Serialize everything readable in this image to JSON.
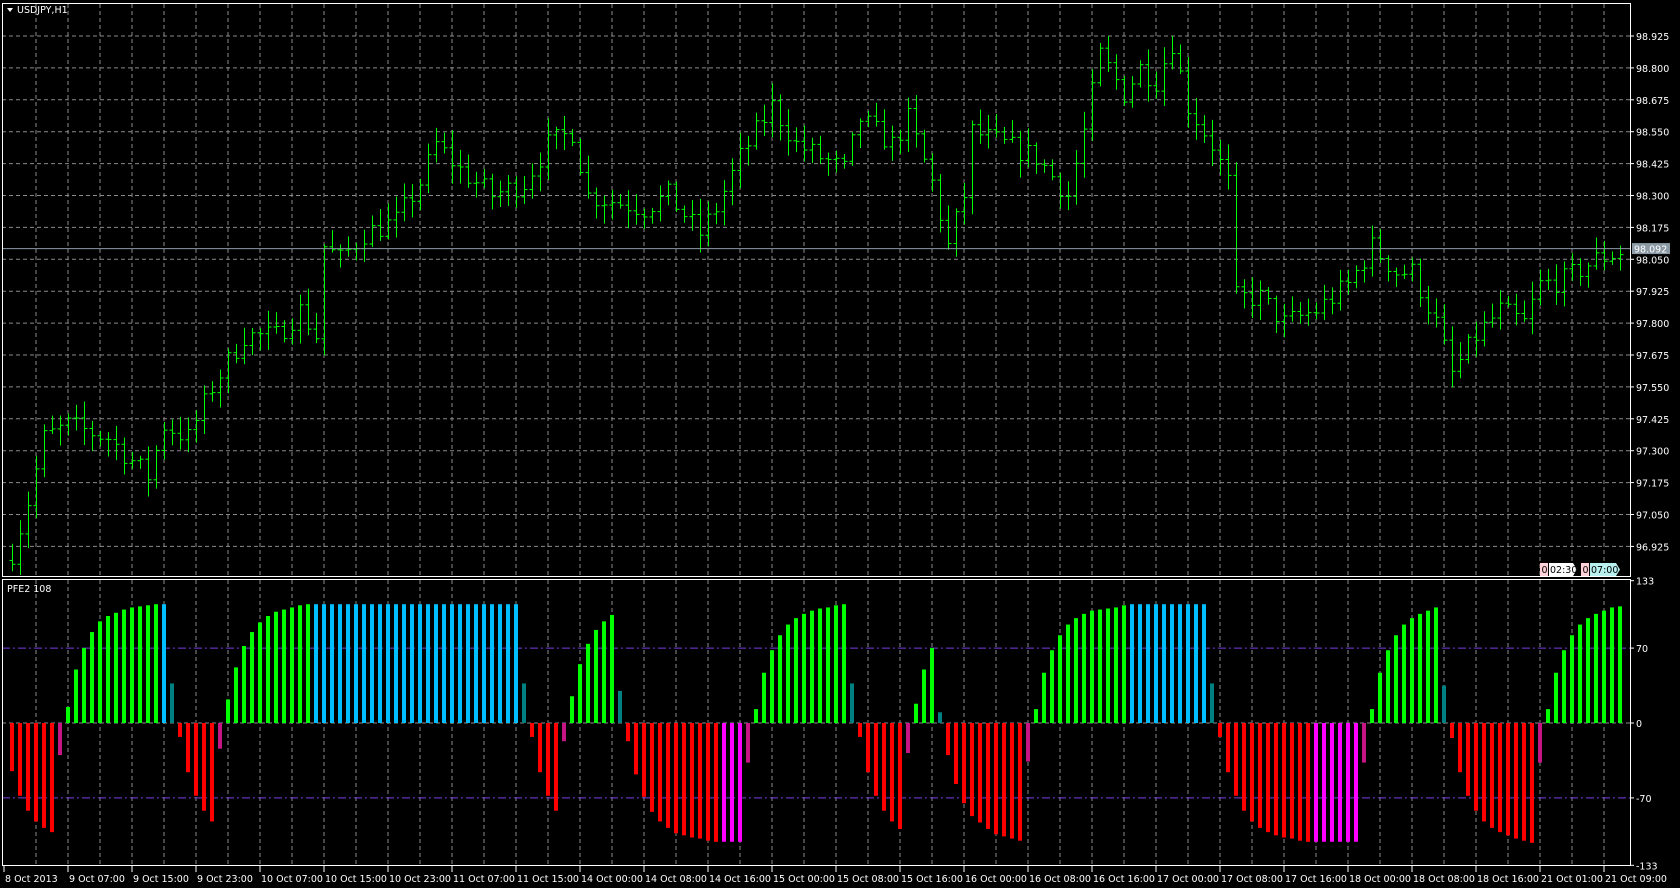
{
  "main_chart": {
    "title": "USDJPY,H1",
    "price_labels": [
      "98.925",
      "98.800",
      "98.675",
      "98.550",
      "98.425",
      "98.300",
      "98.175",
      "98.050",
      "97.925",
      "97.800",
      "97.675",
      "97.550",
      "97.425",
      "97.300",
      "97.175",
      "97.050",
      "96.925"
    ],
    "current_price": "98.092",
    "current_price_value": 98.092,
    "bar_color": "#00ff00",
    "tags": [
      {
        "count": "0",
        "time": "02:30"
      },
      {
        "count": "0",
        "time": "07:00"
      }
    ]
  },
  "indicator": {
    "title": "PFE2 108",
    "levels": [
      "133",
      "70",
      "0",
      "-70",
      "-133"
    ],
    "level_values": [
      133,
      70,
      0,
      -70,
      -133
    ]
  },
  "time_labels": [
    "8 Oct 2013",
    "9 Oct 07:00",
    "9 Oct 15:00",
    "9 Oct 23:00",
    "10 Oct 07:00",
    "10 Oct 15:00",
    "10 Oct 23:00",
    "11 Oct 07:00",
    "11 Oct 15:00",
    "14 Oct 00:00",
    "14 Oct 08:00",
    "14 Oct 16:00",
    "15 Oct 00:00",
    "15 Oct 08:00",
    "15 Oct 16:00",
    "16 Oct 00:00",
    "16 Oct 08:00",
    "16 Oct 16:00",
    "17 Oct 00:00",
    "17 Oct 08:00",
    "17 Oct 16:00",
    "18 Oct 00:00",
    "18 Oct 08:00",
    "18 Oct 16:00",
    "21 Oct 01:00",
    "21 Oct 09:00"
  ],
  "chart_data": [
    {
      "type": "ohlc",
      "title": "USDJPY,H1",
      "ylim": [
        96.86,
        98.99
      ],
      "bar_count": 202,
      "close_keypoints": [
        [
          0,
          96.9
        ],
        [
          2,
          97.1
        ],
        [
          4,
          97.35
        ],
        [
          7,
          97.4
        ],
        [
          12,
          97.35
        ],
        [
          17,
          97.2
        ],
        [
          19,
          97.4
        ],
        [
          22,
          97.35
        ],
        [
          25,
          97.55
        ],
        [
          29,
          97.75
        ],
        [
          33,
          97.75
        ],
        [
          36,
          97.85
        ],
        [
          38,
          97.75
        ],
        [
          39,
          98.1
        ],
        [
          41,
          98.05
        ],
        [
          44,
          98.15
        ],
        [
          48,
          98.2
        ],
        [
          51,
          98.35
        ],
        [
          53,
          98.5
        ],
        [
          56,
          98.4
        ],
        [
          60,
          98.3
        ],
        [
          64,
          98.35
        ],
        [
          67,
          98.5
        ],
        [
          70,
          98.55
        ],
        [
          72,
          98.3
        ],
        [
          79,
          98.25
        ],
        [
          82,
          98.3
        ],
        [
          86,
          98.15
        ],
        [
          88,
          98.25
        ],
        [
          91,
          98.45
        ],
        [
          95,
          98.65
        ],
        [
          98,
          98.5
        ],
        [
          104,
          98.4
        ],
        [
          106,
          98.6
        ],
        [
          110,
          98.5
        ],
        [
          112,
          98.6
        ],
        [
          115,
          98.35
        ],
        [
          117,
          98.1
        ],
        [
          119,
          98.3
        ],
        [
          120,
          98.55
        ],
        [
          124,
          98.5
        ],
        [
          128,
          98.45
        ],
        [
          132,
          98.3
        ],
        [
          134,
          98.55
        ],
        [
          136,
          98.85
        ],
        [
          139,
          98.7
        ],
        [
          141,
          98.8
        ],
        [
          143,
          98.75
        ],
        [
          145,
          98.9
        ],
        [
          147,
          98.65
        ],
        [
          150,
          98.5
        ],
        [
          152,
          98.35
        ],
        [
          153,
          97.9
        ],
        [
          156,
          97.9
        ],
        [
          159,
          97.8
        ],
        [
          163,
          97.85
        ],
        [
          167,
          97.95
        ],
        [
          170,
          98.1
        ],
        [
          173,
          98.0
        ],
        [
          175,
          98.0
        ],
        [
          178,
          97.8
        ],
        [
          180,
          97.6
        ],
        [
          183,
          97.75
        ],
        [
          186,
          97.85
        ],
        [
          189,
          97.8
        ],
        [
          191,
          97.95
        ],
        [
          194,
          97.97
        ],
        [
          198,
          98.05
        ],
        [
          201,
          98.08
        ]
      ]
    },
    {
      "type": "histogram",
      "title": "PFE2 108",
      "ylim": [
        -133,
        133
      ],
      "levels": [
        70,
        0,
        -70
      ],
      "colors": {
        "up": "#00ff00",
        "up_max": "#00bfff",
        "up_fade": "#008080",
        "down": "#ff0000",
        "down_max": "#ff00ff",
        "down_fade": "#c71585"
      },
      "segments": [
        {
          "color": "down",
          "values": [
            -45,
            -68,
            -82,
            -92,
            -98,
            -102
          ]
        },
        {
          "color": "down_fade",
          "values": [
            -30
          ]
        },
        {
          "color": "up",
          "values": [
            15,
            50,
            70,
            85,
            95,
            100,
            103,
            106,
            108,
            109,
            110,
            111
          ]
        },
        {
          "color": "up_max",
          "values": [
            111
          ]
        },
        {
          "color": "up_fade",
          "values": [
            37
          ]
        },
        {
          "color": "down",
          "values": [
            -13,
            -46,
            -68,
            -82,
            -92
          ]
        },
        {
          "color": "down_fade",
          "values": [
            -24
          ]
        },
        {
          "color": "up",
          "values": [
            22,
            52,
            72,
            85,
            94,
            100,
            104,
            106,
            108,
            110,
            111
          ]
        },
        {
          "color": "up_max",
          "values": [
            111,
            111,
            111,
            111,
            111,
            111,
            111,
            111,
            111,
            111,
            111,
            111,
            111,
            111,
            111,
            111,
            111,
            111,
            111,
            111,
            111,
            111,
            111,
            111,
            111,
            111
          ]
        },
        {
          "color": "up_fade",
          "values": [
            37
          ]
        },
        {
          "color": "down",
          "values": [
            -13,
            -46,
            -68,
            -82
          ]
        },
        {
          "color": "down_fade",
          "values": [
            -17
          ]
        },
        {
          "color": "up",
          "values": [
            25,
            55,
            74,
            87,
            95,
            101
          ]
        },
        {
          "color": "up_fade",
          "values": [
            30
          ]
        },
        {
          "color": "down",
          "values": [
            -17,
            -48,
            -69,
            -83,
            -92,
            -98,
            -103,
            -105,
            -107,
            -108,
            -110,
            -111
          ]
        },
        {
          "color": "down_max",
          "values": [
            -111,
            -111,
            -111
          ]
        },
        {
          "color": "down_fade",
          "values": [
            -37
          ]
        },
        {
          "color": "up",
          "values": [
            13,
            47,
            68,
            82,
            92,
            98,
            102,
            105,
            107,
            108,
            110,
            111
          ]
        },
        {
          "color": "up_fade",
          "values": [
            37
          ]
        },
        {
          "color": "down",
          "values": [
            -13,
            -46,
            -68,
            -82,
            -92,
            -99
          ]
        },
        {
          "color": "down_fade",
          "values": [
            -28
          ]
        },
        {
          "color": "up",
          "values": [
            18,
            50,
            70
          ]
        },
        {
          "color": "up_fade",
          "values": [
            10
          ]
        },
        {
          "color": "down",
          "values": [
            -30,
            -57,
            -75,
            -87,
            -93,
            -99,
            -104,
            -106,
            -108,
            -110
          ]
        },
        {
          "color": "down_fade",
          "values": [
            -36
          ]
        },
        {
          "color": "up",
          "values": [
            13,
            47,
            68,
            82,
            92,
            98,
            102,
            105,
            106,
            107,
            108,
            110
          ]
        },
        {
          "color": "up_max",
          "values": [
            111,
            111,
            111,
            111,
            111,
            111,
            111,
            111,
            111,
            111
          ]
        },
        {
          "color": "up_fade",
          "values": [
            37
          ]
        },
        {
          "color": "down",
          "values": [
            -13,
            -46,
            -68,
            -82,
            -92,
            -98,
            -102,
            -105,
            -107,
            -108,
            -110,
            -111
          ]
        },
        {
          "color": "down_max",
          "values": [
            -111,
            -111,
            -111,
            -111,
            -111,
            -111
          ]
        },
        {
          "color": "down_fade",
          "values": [
            -37
          ]
        },
        {
          "color": "up",
          "values": [
            13,
            47,
            68,
            82,
            92,
            98,
            102,
            105,
            108
          ]
        },
        {
          "color": "up_fade",
          "values": [
            35
          ]
        },
        {
          "color": "down",
          "values": [
            -14,
            -46,
            -68,
            -82,
            -92,
            -98,
            -102,
            -105,
            -108,
            -110,
            -112
          ]
        },
        {
          "color": "down_fade",
          "values": [
            -37
          ]
        },
        {
          "color": "up",
          "values": [
            13,
            47,
            68,
            82,
            92,
            98,
            102,
            105,
            108,
            109
          ]
        }
      ]
    }
  ]
}
